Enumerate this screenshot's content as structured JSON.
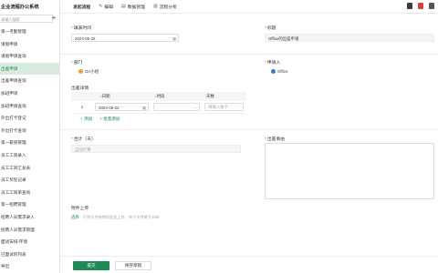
{
  "app": {
    "title": "企业流程办公系统"
  },
  "sidebar": {
    "search_placeholder": "请输入搜索",
    "add_symbol": "+",
    "items": [
      {
        "label": "第一考勤管理",
        "active": false
      },
      {
        "label": "请假申请",
        "active": false
      },
      {
        "label": "请假申请查询",
        "active": false
      },
      {
        "label": "出差申请",
        "active": true
      },
      {
        "label": "出差申请查询",
        "active": false
      },
      {
        "label": "加班申请",
        "active": false
      },
      {
        "label": "加班申请查询",
        "active": false
      },
      {
        "label": "外出打卡登记",
        "active": false
      },
      {
        "label": "外出打卡查询",
        "active": false
      },
      {
        "label": "第一薪资管理",
        "active": false
      },
      {
        "label": "员工工资录入",
        "active": false
      },
      {
        "label": "员工工资汇总表",
        "active": false
      },
      {
        "label": "员工奖惩记录",
        "active": false
      },
      {
        "label": "员工工资单查询",
        "active": false
      },
      {
        "label": "第一招聘管理",
        "active": false
      },
      {
        "label": "招聘人员需求录入",
        "active": false
      },
      {
        "label": "招聘人员需求管理",
        "active": false
      },
      {
        "label": "面试安排-环境",
        "active": false
      },
      {
        "label": "已面试的列表",
        "active": false
      },
      {
        "label": "导出",
        "active": false
      }
    ]
  },
  "topbar": {
    "tabs": [
      {
        "icon": "",
        "label": "发起流程"
      },
      {
        "icon": "✎",
        "label": "编辑"
      },
      {
        "icon": "▤",
        "label": "数据管理"
      },
      {
        "icon": "▥",
        "label": "流程分析"
      }
    ]
  },
  "form": {
    "fill_time": {
      "label": "填表时间",
      "value": "2024-05-22"
    },
    "title": {
      "label": "标题",
      "value": "Office的出差申请"
    },
    "department": {
      "label": "部门",
      "value": "OA小组"
    },
    "applicant": {
      "label": "申请人",
      "value": "Office"
    },
    "detail": {
      "label": "出差详情",
      "columns": [
        "",
        "日期",
        "时段",
        "天数"
      ],
      "rows": [
        {
          "index": "1",
          "date": "2024-05-22",
          "period": "",
          "days_placeholder": "请输入数字"
        }
      ],
      "add_label": "+ 添加",
      "batch_label": "+ 批量添加"
    },
    "total": {
      "label": "合计（天）",
      "placeholder": "自动计算"
    },
    "reason": {
      "label": "出差事由"
    },
    "attachment": {
      "label": "附件上传",
      "button_label": "选择",
      "hint": "可将文件拖拽到此处上传，单个文件最大10M"
    }
  },
  "footer": {
    "submit_label": "提交",
    "save_label": "保存草稿"
  },
  "colors": {
    "accent": "#1f8a57",
    "active_bg": "#d8eadf"
  }
}
